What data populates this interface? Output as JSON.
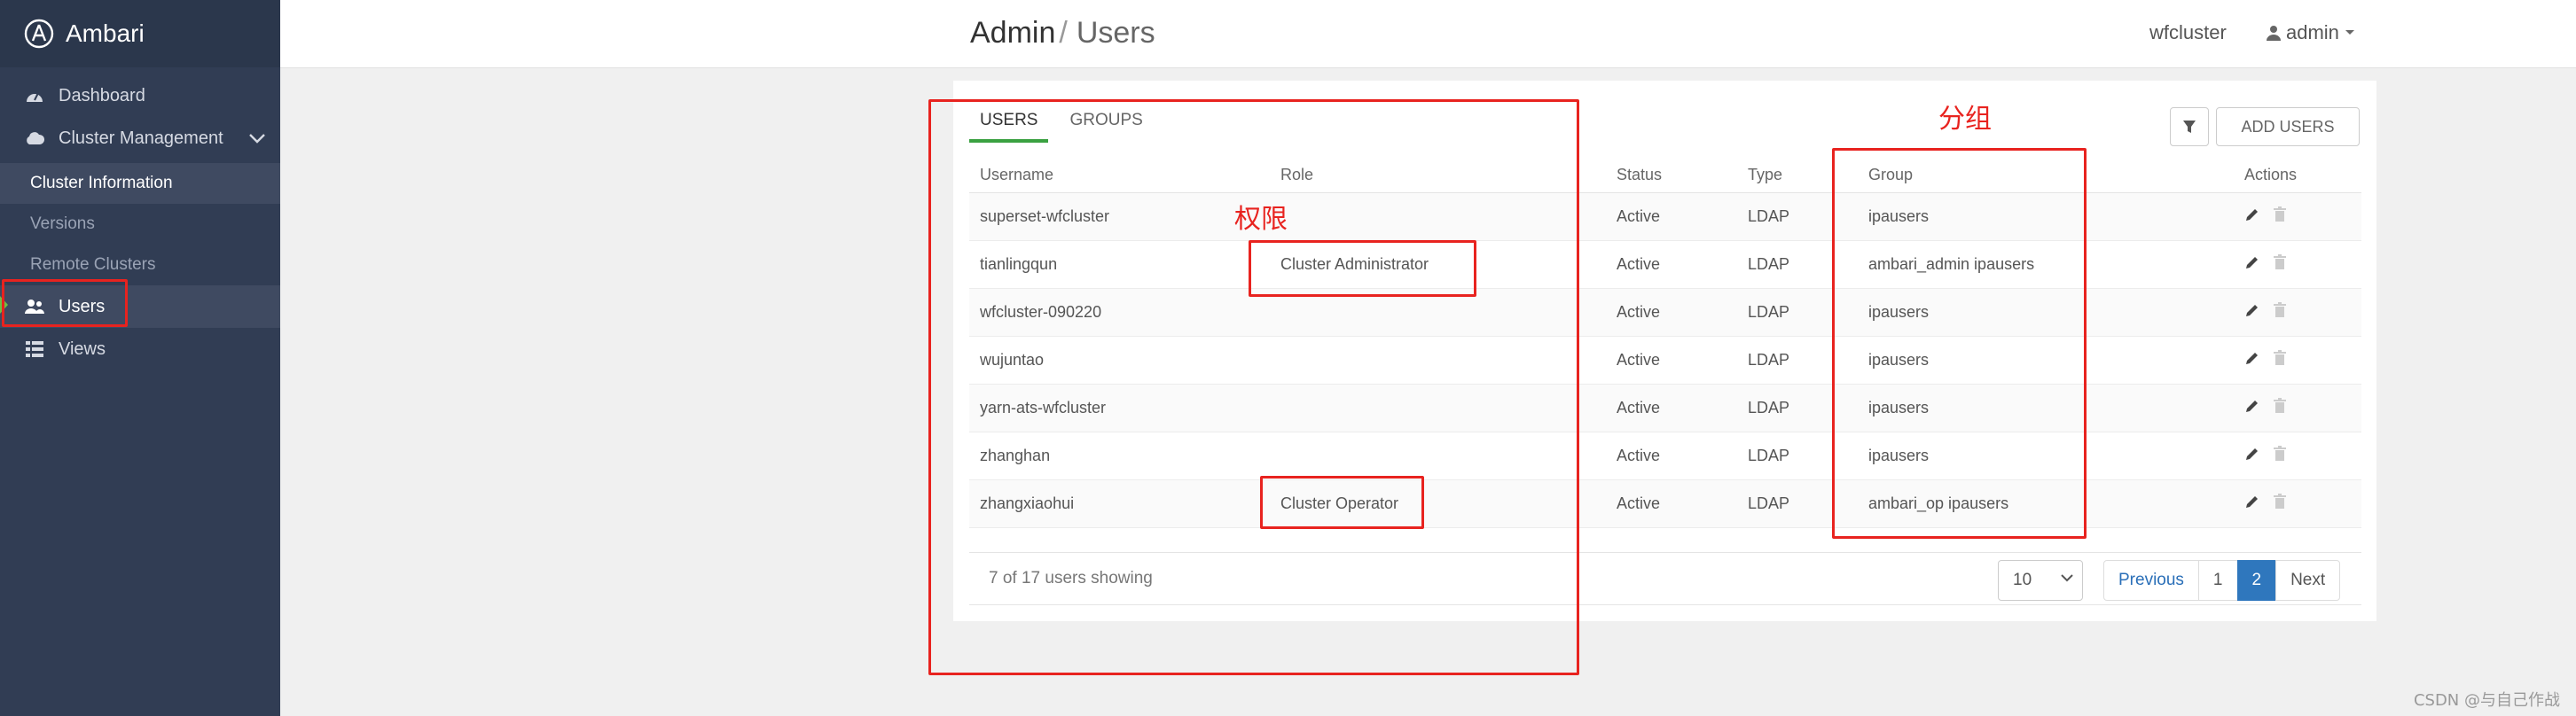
{
  "brand": {
    "name": "Ambari"
  },
  "sidebar": {
    "items": [
      {
        "label": "Dashboard",
        "icon": "dashboard-icon"
      },
      {
        "label": "Cluster Management",
        "icon": "cloud-icon"
      },
      {
        "label": "Users",
        "icon": "users-icon"
      },
      {
        "label": "Views",
        "icon": "grid-icon"
      }
    ],
    "sub_items": [
      "Cluster Information",
      "Versions",
      "Remote Clusters"
    ]
  },
  "header": {
    "breadcrumb_root": "Admin",
    "breadcrumb_sep": "/",
    "breadcrumb_current": "Users",
    "cluster_name": "wfcluster",
    "user": "admin"
  },
  "tabs": [
    {
      "label": "USERS"
    },
    {
      "label": "GROUPS"
    }
  ],
  "toolbar": {
    "filter_icon": "filter-icon",
    "add_users_label": "ADD USERS"
  },
  "table": {
    "columns": [
      "Username",
      "Role",
      "Status",
      "Type",
      "Group",
      "Actions"
    ],
    "rows": [
      {
        "username": "superset-wfcluster",
        "role": "",
        "status": "Active",
        "type": "LDAP",
        "group": "ipausers"
      },
      {
        "username": "tianlingqun",
        "role": "Cluster Administrator",
        "status": "Active",
        "type": "LDAP",
        "group": "ambari_admin ipausers"
      },
      {
        "username": "wfcluster-090220",
        "role": "",
        "status": "Active",
        "type": "LDAP",
        "group": "ipausers"
      },
      {
        "username": "wujuntao",
        "role": "",
        "status": "Active",
        "type": "LDAP",
        "group": "ipausers"
      },
      {
        "username": "yarn-ats-wfcluster",
        "role": "",
        "status": "Active",
        "type": "LDAP",
        "group": "ipausers"
      },
      {
        "username": "zhanghan",
        "role": "",
        "status": "Active",
        "type": "LDAP",
        "group": "ipausers"
      },
      {
        "username": "zhangxiaohui",
        "role": "Cluster Operator",
        "status": "Active",
        "type": "LDAP",
        "group": "ambari_op ipausers"
      }
    ]
  },
  "footer": {
    "showing": "7 of 17 users showing",
    "per_page": "10",
    "pagination": {
      "previous": "Previous",
      "pages": [
        "1",
        "2"
      ],
      "current": "2",
      "next": "Next"
    }
  },
  "annotations": {
    "permissions": "权限",
    "grouping": "分组"
  },
  "watermark": "CSDN @与自己作战",
  "colors": {
    "sidebar": "#313d54",
    "accent_green": "#3aa141",
    "annotation_red": "#e8231f",
    "pager_active": "#2f77bd"
  }
}
